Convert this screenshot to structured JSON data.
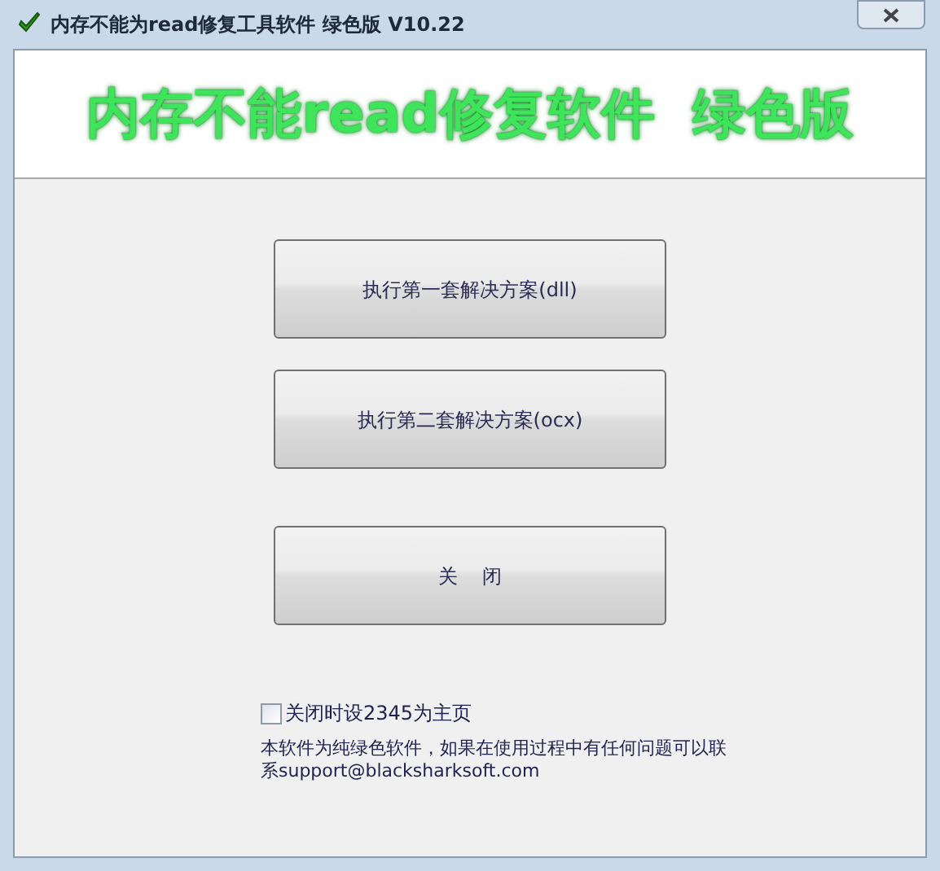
{
  "window": {
    "title": "内存不能为read修复工具软件 绿色版 V10.22"
  },
  "banner": {
    "text": "内存不能read修复软件  绿色版"
  },
  "buttons": [
    {
      "label": "执行第一套解决方案(dll)"
    },
    {
      "label": "执行第二套解决方案(ocx)"
    },
    {
      "label": "关    闭"
    }
  ],
  "checkbox": {
    "label": "关闭时设2345为主页",
    "checked": false
  },
  "note": "本软件为纯绿色软件，如果在使用过程中有任何问题可以联系support@blacksharksoft.com"
}
